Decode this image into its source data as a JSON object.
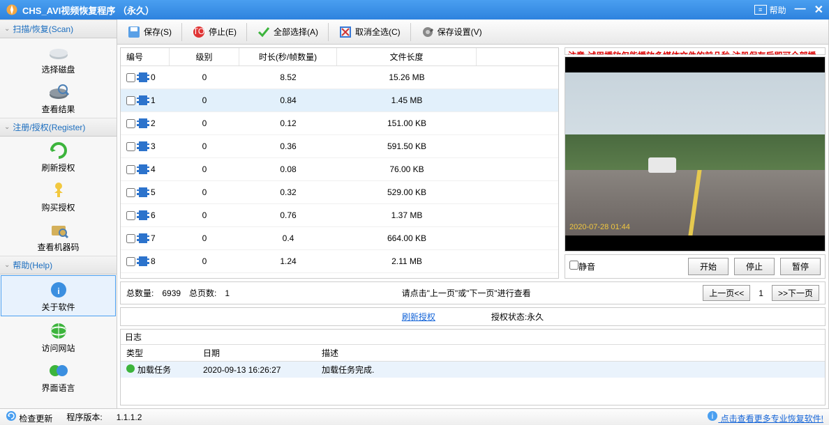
{
  "titlebar": {
    "title": "CHS_AVI视频恢复程序 （永久）",
    "help": "帮助"
  },
  "sidebar": {
    "sections": [
      {
        "header": "扫描/恢复(Scan)",
        "items": [
          {
            "label": "选择磁盘",
            "name": "sidebar-item-select-disk"
          },
          {
            "label": "查看结果",
            "name": "sidebar-item-view-results"
          }
        ]
      },
      {
        "header": "注册/授权(Register)",
        "items": [
          {
            "label": "刷新授权",
            "name": "sidebar-item-refresh-auth"
          },
          {
            "label": "购买授权",
            "name": "sidebar-item-buy-auth"
          },
          {
            "label": "查看机器码",
            "name": "sidebar-item-machine-code"
          }
        ]
      },
      {
        "header": "帮助(Help)",
        "items": [
          {
            "label": "关于软件",
            "name": "sidebar-item-about",
            "active": true
          },
          {
            "label": "访问网站",
            "name": "sidebar-item-website"
          },
          {
            "label": "界面语言",
            "name": "sidebar-item-language"
          }
        ]
      }
    ]
  },
  "toolbar": {
    "save": "保存(S)",
    "stop": "停止(E)",
    "select_all": "全部选择(A)",
    "deselect_all": "取消全选(C)",
    "save_settings": "保存设置(V)"
  },
  "table": {
    "headers": {
      "num": "编号",
      "lvl": "级别",
      "dur": "时长(秒/帧数量)",
      "size": "文件长度"
    },
    "rows": [
      {
        "num": "0",
        "lvl": "0",
        "dur": "8.52",
        "size": "15.26 MB"
      },
      {
        "num": "1",
        "lvl": "0",
        "dur": "0.84",
        "size": "1.45 MB",
        "selected": true
      },
      {
        "num": "2",
        "lvl": "0",
        "dur": "0.12",
        "size": "151.00 KB"
      },
      {
        "num": "3",
        "lvl": "0",
        "dur": "0.36",
        "size": "591.50 KB"
      },
      {
        "num": "4",
        "lvl": "0",
        "dur": "0.08",
        "size": "76.00 KB"
      },
      {
        "num": "5",
        "lvl": "0",
        "dur": "0.32",
        "size": "529.00 KB"
      },
      {
        "num": "6",
        "lvl": "0",
        "dur": "0.76",
        "size": "1.37 MB"
      },
      {
        "num": "7",
        "lvl": "0",
        "dur": "0.4",
        "size": "664.00 KB"
      },
      {
        "num": "8",
        "lvl": "0",
        "dur": "1.24",
        "size": "2.11 MB"
      }
    ]
  },
  "pager": {
    "total_count_lbl": "总数量:",
    "total_count": "6939",
    "total_pages_lbl": "总页数:",
    "total_pages": "1",
    "hint": "请点击\"上一页\"或\"下一页\"进行查看",
    "prev": "上一页<<",
    "cur": "1",
    "next": ">>下一页"
  },
  "preview": {
    "notice": "注意:试用播放仅能播放多媒体文件的前几秒,注册保存后即可全部播放!",
    "timestamp": "2020-07-28 01:44",
    "mute": "静音",
    "start": "开始",
    "stop": "停止",
    "pause": "暂停"
  },
  "auth": {
    "refresh": "刷新授权",
    "status": "授权状态:永久"
  },
  "log": {
    "title": "日志",
    "headers": {
      "type": "类型",
      "date": "日期",
      "desc": "描述"
    },
    "rows": [
      {
        "type": "加载任务",
        "date": "2020-09-13 16:26:27",
        "desc": "加载任务完成."
      }
    ]
  },
  "statusbar": {
    "check_update": "检查更新",
    "version_lbl": "程序版本:",
    "version": "1.1.1.2",
    "more_link": "点击查看更多专业恢复软件!"
  }
}
